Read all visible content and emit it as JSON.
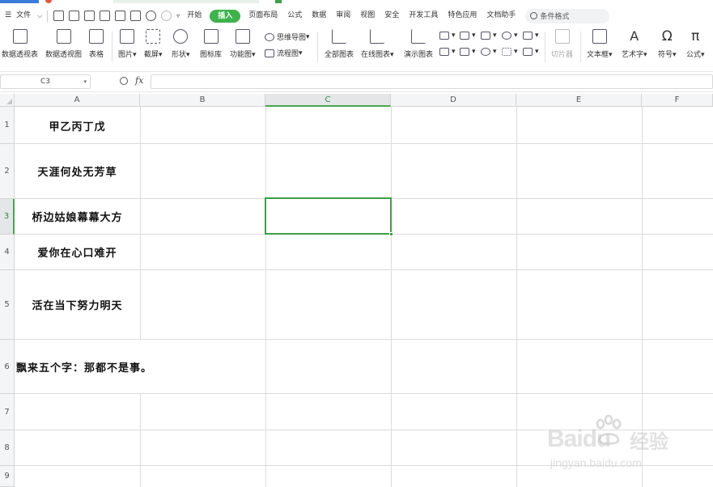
{
  "menu": {
    "file": "文件",
    "tabs": [
      "开始",
      "插入",
      "页面布局",
      "公式",
      "数据",
      "审阅",
      "视图",
      "安全",
      "开发工具",
      "特色应用",
      "文档助手"
    ],
    "active_tab": "插入",
    "search": "条件格式"
  },
  "ribbon": {
    "pivot_table": "数据透视表",
    "pivot_chart": "数据透视图",
    "table": "表格",
    "picture": "图片",
    "screenshot": "截屏",
    "shape": "形状",
    "icon_lib": "图标库",
    "function_chart": "功能图",
    "mindmap": "思维导图",
    "flowchart": "流程图",
    "all_charts": "全部图表",
    "online_chart": "在线图表",
    "demo_chart": "演示图表",
    "slicer": "切片器",
    "textbox": "文本框",
    "wordart": "艺术字",
    "symbol": "符号",
    "formula": "公式"
  },
  "formula_bar": {
    "name_box": "C3",
    "fx": "fx",
    "value": ""
  },
  "grid": {
    "columns": [
      "A",
      "B",
      "C",
      "D",
      "E",
      "F"
    ],
    "selected_column": "C",
    "rows": [
      "1",
      "2",
      "3",
      "4",
      "5",
      "6",
      "7",
      "8",
      "9"
    ],
    "selected_row": "3",
    "cells": {
      "A1": "甲乙丙丁戊",
      "A2": "天涯何处无芳草",
      "A3": "桥边姑娘幕幕大方",
      "A4": "爱你在心口难开",
      "A5": "活在当下努力明天",
      "A6": "飘来五个字：那都不是事。"
    }
  },
  "watermark": {
    "brand": "Baidu",
    "brand_cn": "经验",
    "site": "jingyan.baidu.com"
  },
  "colors": {
    "accent": "#3db34a",
    "selection": "#3fa045"
  }
}
